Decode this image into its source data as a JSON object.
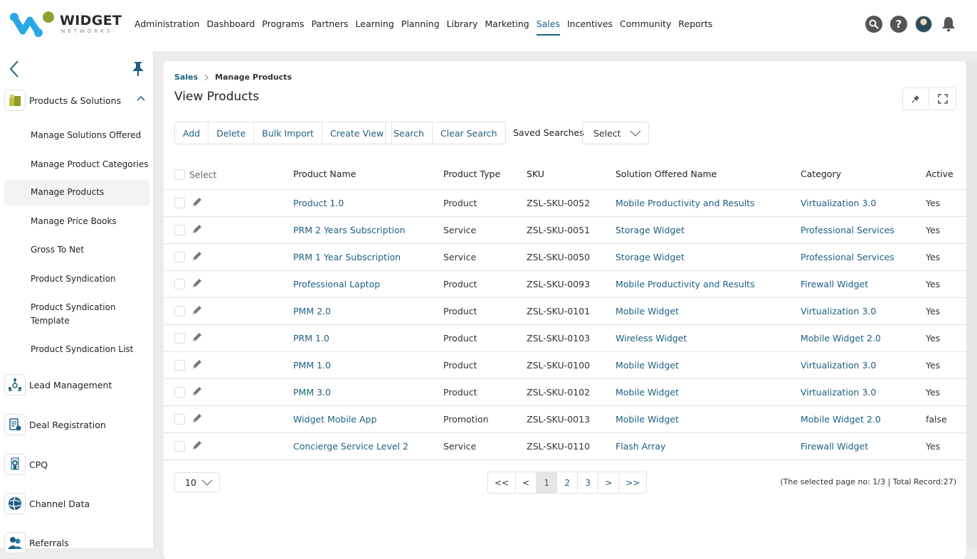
{
  "header": {
    "logo": {
      "word": "WIDGET",
      "sub": "NETWORKS"
    },
    "nav": [
      "Administration",
      "Dashboard",
      "Programs",
      "Partners",
      "Learning",
      "Planning",
      "Library",
      "Marketing",
      "Sales",
      "Incentives",
      "Community",
      "Reports"
    ],
    "active_nav": "Sales",
    "icons": [
      "search-icon",
      "help-icon",
      "avatar",
      "bell-icon"
    ]
  },
  "sidebar": {
    "groups": [
      {
        "label": "Products & Solutions",
        "icon": "box-icon",
        "expanded": true,
        "items": [
          "Manage Solutions Offered",
          "Manage Product Categories",
          "Manage Products",
          "Manage Price Books",
          "Gross To Net",
          "Product Syndication",
          "Product Syndication Template",
          "Product Syndication List"
        ],
        "active_item": "Manage Products"
      },
      {
        "label": "Lead Management",
        "icon": "org-chart-icon"
      },
      {
        "label": "Deal Registration",
        "icon": "document-icon"
      },
      {
        "label": "CPQ",
        "icon": "certificate-icon"
      },
      {
        "label": "Channel Data",
        "icon": "globe-icon"
      },
      {
        "label": "Referrals",
        "icon": "users-icon"
      }
    ]
  },
  "breadcrumb": {
    "parent": "Sales",
    "current": "Manage Products"
  },
  "page_title": "View Products",
  "toolbar": {
    "group1": [
      "Add",
      "Delete",
      "Bulk Import",
      "Create View"
    ],
    "group2": [
      "Search",
      "Clear Search"
    ],
    "saved_searches_label": "Saved Searches",
    "saved_searches_value": "Select"
  },
  "table": {
    "select_label": "Select",
    "columns": [
      "Product Name",
      "Product Type",
      "SKU",
      "Solution Offered Name",
      "Category",
      "Active"
    ],
    "rows": [
      [
        "Product 1.0",
        "Product",
        "ZSL-SKU-0052",
        "Mobile Productivity and Results",
        "Virtualization 3.0",
        "Yes"
      ],
      [
        "PRM 2 Years Subscription",
        "Service",
        "ZSL-SKU-0051",
        "Storage Widget",
        "Professional Services",
        "Yes"
      ],
      [
        "PRM 1 Year Subscription",
        "Service",
        "ZSL-SKU-0050",
        "Storage Widget",
        "Professional Services",
        "Yes"
      ],
      [
        "Professional Laptop",
        "Product",
        "ZSL-SKU-0093",
        "Mobile Productivity and Results",
        "Firewall Widget",
        "Yes"
      ],
      [
        "PMM 2.0",
        "Product",
        "ZSL-SKU-0101",
        "Mobile Widget",
        "Virtualization 3.0",
        "Yes"
      ],
      [
        "PRM 1.0",
        "Product",
        "ZSL-SKU-0103",
        "Wireless Widget",
        "Mobile Widget 2.0",
        "Yes"
      ],
      [
        "PMM 1.0",
        "Product",
        "ZSL-SKU-0100",
        "Mobile Widget",
        "Virtualization 3.0",
        "Yes"
      ],
      [
        "PMM 3.0",
        "Product",
        "ZSL-SKU-0102",
        "Mobile Widget",
        "Virtualization 3.0",
        "Yes"
      ],
      [
        "Widget Mobile App",
        "Promotion",
        "ZSL-SKU-0013",
        "Mobile Widget",
        "Mobile Widget 2.0",
        "false"
      ],
      [
        "Concierge Service Level 2",
        "Service",
        "ZSL-SKU-0110",
        "Flash Array",
        "Firewall Widget",
        "Yes"
      ]
    ]
  },
  "pagination": {
    "page_size": "10",
    "buttons": [
      "<<",
      "<",
      "1",
      "2",
      "3",
      ">",
      ">>"
    ],
    "current_page": "1",
    "info": "(The selected page no: 1/3 | Total Record:27)"
  },
  "colors": {
    "accent": "#1d5f82",
    "logo_blue": "#29a8e8",
    "logo_green": "#8aa332"
  }
}
